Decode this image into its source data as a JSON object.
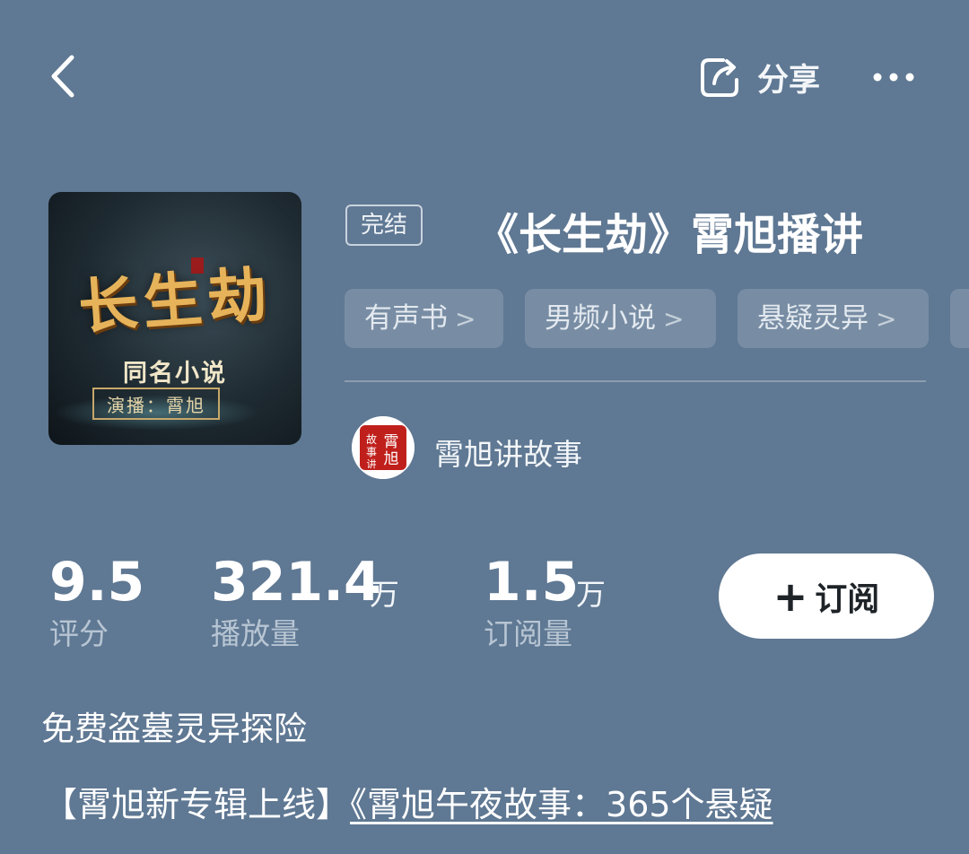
{
  "header": {
    "share_label": "分享"
  },
  "cover": {
    "title_text": "长生劫",
    "subtitle_text": "同名小说",
    "narrator_text": "演播：霄旭"
  },
  "album": {
    "status_badge": "完结",
    "title": "《长生劫》霄旭播讲",
    "tags": [
      "有声书",
      "男频小说",
      "悬疑灵异"
    ]
  },
  "author": {
    "name": "霄旭讲故事",
    "avatar_text_main": "霄旭",
    "avatar_text_side": "故事",
    "avatar_text_bottom": "讲"
  },
  "stats": {
    "rating_value": "9.5",
    "rating_label": "评分",
    "plays_value": "321.4",
    "plays_unit": "万",
    "plays_label": "播放量",
    "subs_value": "1.5",
    "subs_unit": "万",
    "subs_label": "订阅量"
  },
  "subscribe": {
    "icon": "plus-icon",
    "label": "订阅"
  },
  "description": {
    "intro": "免费盗墓灵异探险",
    "promo_prefix": "【霄旭新专辑上线】",
    "promo_link": "《霄旭午夜故事：365个悬疑"
  },
  "colors": {
    "background": "#5f7893",
    "tag_bg": "rgba(255,255,255,0.16)",
    "button_bg": "#ffffff",
    "seal_red": "#c0201c"
  }
}
